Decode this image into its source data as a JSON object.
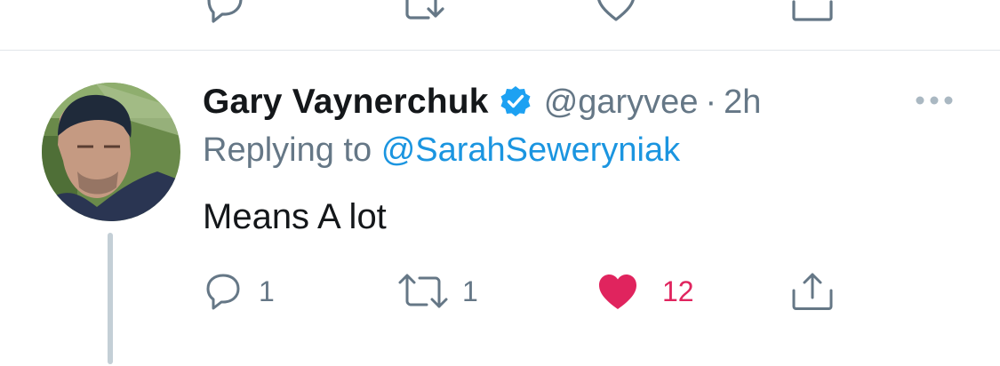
{
  "prev_tweet": {
    "icons": [
      "reply-icon",
      "retweet-icon",
      "like-icon",
      "share-icon"
    ]
  },
  "tweet": {
    "author": {
      "display_name": "Gary Vaynerchuk",
      "verified": true,
      "handle": "@garyvee",
      "separator": "·",
      "time": "2h"
    },
    "replying_prefix": "Replying to",
    "replying_to": "@SarahSeweryniak",
    "text": "Means A lot",
    "actions": {
      "reply_count": "1",
      "retweet_count": "1",
      "like_count": "12",
      "liked": true
    }
  },
  "colors": {
    "primary_text": "#14171a",
    "secondary_text": "#657786",
    "link": "#1b95e0",
    "like": "#e0245e",
    "verified": "#1da1f2",
    "thread_line": "#c4cfd6"
  },
  "icons": {
    "verified": "verified-badge-icon",
    "more": "more-horizontal-icon",
    "reply": "reply-icon",
    "retweet": "retweet-icon",
    "like": "heart-filled-icon",
    "share": "share-icon"
  }
}
